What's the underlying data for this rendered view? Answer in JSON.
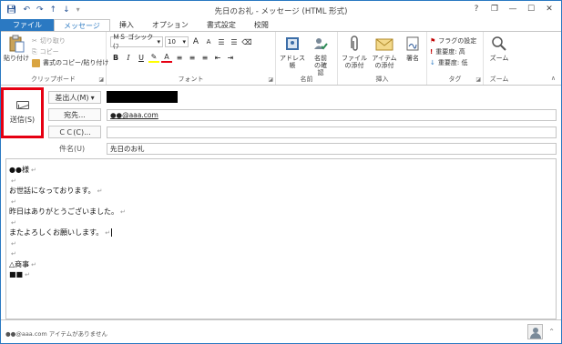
{
  "window": {
    "title": "先日のお礼 - メッセージ (HTML 形式)"
  },
  "qat": {
    "icons": [
      "save-icon",
      "undo-icon",
      "redo-icon",
      "up-arrow-icon",
      "down-arrow-icon",
      "qat-dropdown-icon"
    ]
  },
  "window_controls": {
    "help": "?",
    "restore": "❐",
    "minimize": "—",
    "maximize": "☐",
    "close": "✕"
  },
  "tabs": [
    "ファイル",
    "メッセージ",
    "挿入",
    "オプション",
    "書式設定",
    "校閲"
  ],
  "ribbon": {
    "clipboard": {
      "paste": "貼り付け",
      "cut": "切り取り",
      "copy": "コピー",
      "format_painter": "書式のコピー/貼り付け",
      "label": "クリップボード"
    },
    "font": {
      "font_name": "ＭＳ ゴシック (ﾌ",
      "font_size": "10",
      "grow": "A",
      "shrink": "A",
      "bold": "B",
      "italic": "I",
      "underline": "U",
      "label": "フォント"
    },
    "names": {
      "address_book": "アドレス帳",
      "check_names": "名前の確認",
      "label": "名前"
    },
    "insert": {
      "attach_file": "ファイルの添付",
      "attach_item": "アイテムの添付",
      "signature": "署名",
      "label": "挿入"
    },
    "tags": {
      "followup": "フラグの設定",
      "high": "重要度: 高",
      "low": "重要度: 低",
      "label": "タグ"
    },
    "zoom": {
      "zoom": "ズーム",
      "label": "ズーム"
    }
  },
  "header": {
    "send": "送信(S)",
    "from": "差出人(M)",
    "to": "宛先...",
    "to_value": "●●@aaa.com",
    "cc": "ＣＣ(C)...",
    "cc_value": "",
    "subject_label": "件名(U)",
    "subject_value": "先日のお礼"
  },
  "body": {
    "lines": [
      "●●様",
      "",
      "お世話になっております。",
      "",
      "昨日はありがとうございました。",
      "",
      "またよろしくお願いします。",
      "",
      "",
      "△商事",
      "■■"
    ],
    "para_mark": "↵"
  },
  "status": {
    "text": "●●@aaa.com アイテムがありません"
  },
  "colors": {
    "accent": "#2b79c2",
    "highlight_border": "#e60012"
  }
}
